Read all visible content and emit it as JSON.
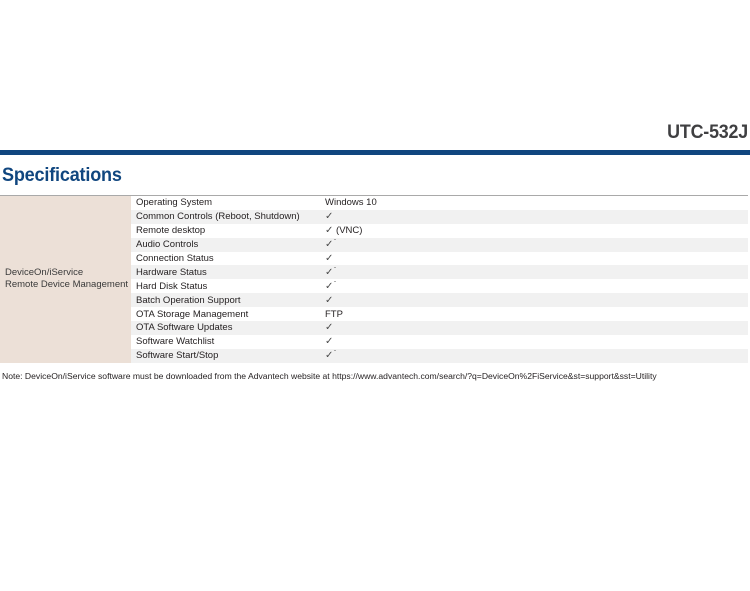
{
  "header": {
    "model_number": "UTC-532J"
  },
  "section": {
    "title": "Specifications"
  },
  "spec_table": {
    "category": "DeviceOn/iService\nRemote Device Management",
    "rows": [
      {
        "feature": "Operating System",
        "value": "Windows 10",
        "mark": "",
        "star": false
      },
      {
        "feature": "Common Controls (Reboot, Shutdown)",
        "value": "",
        "mark": "✓",
        "star": false
      },
      {
        "feature": "Remote desktop",
        "value": " (VNC)",
        "mark": "✓",
        "star": false
      },
      {
        "feature": "Audio Controls",
        "value": "",
        "mark": "✓",
        "star": true
      },
      {
        "feature": "Connection Status",
        "value": "",
        "mark": "✓",
        "star": false
      },
      {
        "feature": "Hardware Status",
        "value": "",
        "mark": "✓",
        "star": true
      },
      {
        "feature": "Hard Disk Status",
        "value": "",
        "mark": "✓",
        "star": true
      },
      {
        "feature": "Batch Operation Support",
        "value": "",
        "mark": "✓",
        "star": false
      },
      {
        "feature": "OTA Storage Management",
        "value": "FTP",
        "mark": "",
        "star": false
      },
      {
        "feature": "OTA Software Updates",
        "value": "",
        "mark": "✓",
        "star": false
      },
      {
        "feature": "Software Watchlist",
        "value": "",
        "mark": "✓",
        "star": false
      },
      {
        "feature": "Software Start/Stop",
        "value": "",
        "mark": "✓",
        "star": true
      }
    ]
  },
  "footnote": {
    "text": "Note: DeviceOn/iService software must be downloaded from the Advantech website at https://www.advantech.com/search/?q=DeviceOn%2FiService&st=support&sst=Utility"
  },
  "colors": {
    "navy": "#10467f",
    "beige": "#ece0d7",
    "row_shaded": "#f1f1f1",
    "model_text": "#3f3f41"
  }
}
